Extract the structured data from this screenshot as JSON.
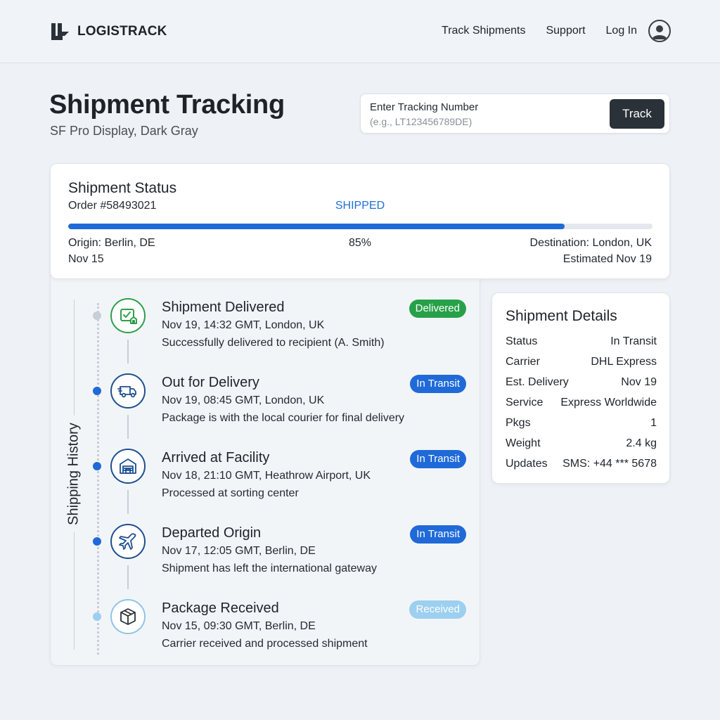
{
  "brand": {
    "name": "LOGISTRACK"
  },
  "nav": {
    "items": [
      "Track Shipments",
      "Support",
      "Log In"
    ]
  },
  "page": {
    "title": "Shipment Tracking",
    "subtitle": "SF Pro Display, Dark Gray"
  },
  "search": {
    "label": "Enter Tracking Number",
    "placeholder": "(e.g., LT123456789DE)",
    "value": "",
    "button": "Track"
  },
  "status": {
    "title": "Shipment Status",
    "order": "Order #58493021",
    "state": "SHIPPED",
    "progress_percent": 85,
    "progress_label": "85%",
    "origin": "Origin: Berlin, DE",
    "origin_date": "Nov 15",
    "destination": "Destination: London, UK",
    "estimated": "Estimated Nov 19"
  },
  "history": {
    "label": "Shipping History",
    "events": [
      {
        "title": "Shipment Delivered",
        "meta": "Nov 19, 14:32 GMT, London, UK",
        "desc": "Successfully delivered to recipient (A. Smith)",
        "badge": "Delivered",
        "badge_color": "#27a149",
        "icon": "delivered-box-check-icon",
        "icon_color": "#2e9e4a",
        "node_color": "#c8ced5"
      },
      {
        "title": "Out for Delivery",
        "meta": "Nov 19, 08:45 GMT, London, UK",
        "desc": "Package is with the local courier for final delivery",
        "badge": "In Transit",
        "badge_color": "#1f6ad8",
        "icon": "delivery-truck-icon",
        "icon_color": "#1e4f8f",
        "node_color": "#1f6ad8"
      },
      {
        "title": "Arrived at Facility",
        "meta": "Nov 18, 21:10 GMT, Heathrow Airport, UK",
        "desc": "Processed at sorting center",
        "badge": "In Transit",
        "badge_color": "#1f6ad8",
        "icon": "warehouse-icon",
        "icon_color": "#1e4f8f",
        "node_color": "#1f6ad8"
      },
      {
        "title": "Departed Origin",
        "meta": "Nov 17, 12:05 GMT, Berlin, DE",
        "desc": "Shipment has left the international gateway",
        "badge": "In Transit",
        "badge_color": "#1f6ad8",
        "icon": "airplane-icon",
        "icon_color": "#1e4f8f",
        "node_color": "#1f6ad8"
      },
      {
        "title": "Package Received",
        "meta": "Nov 15, 09:30 GMT, Berlin, DE",
        "desc": "Carrier received and processed shipment",
        "badge": "Received",
        "badge_color": "#9ccff0",
        "icon": "package-box-icon",
        "icon_color": "#8fc4e8",
        "node_color": "#9ccff0"
      }
    ]
  },
  "details": {
    "title": "Shipment Details",
    "rows": [
      {
        "key": "Status",
        "value": "In Transit"
      },
      {
        "key": "Carrier",
        "value": "DHL Express"
      },
      {
        "key": "Est. Delivery",
        "value": "Nov 19"
      },
      {
        "key": "Service",
        "value": "Express Worldwide"
      },
      {
        "key": "Pkgs",
        "value": "1"
      },
      {
        "key": "Weight",
        "value": "2.4 kg"
      },
      {
        "key": "Updates",
        "value": "SMS: +44 *** 5678"
      }
    ]
  },
  "colors": {
    "accent": "#1f6ad8",
    "success": "#27a149",
    "button_dark": "#2b3138",
    "background": "#eef2f6"
  }
}
